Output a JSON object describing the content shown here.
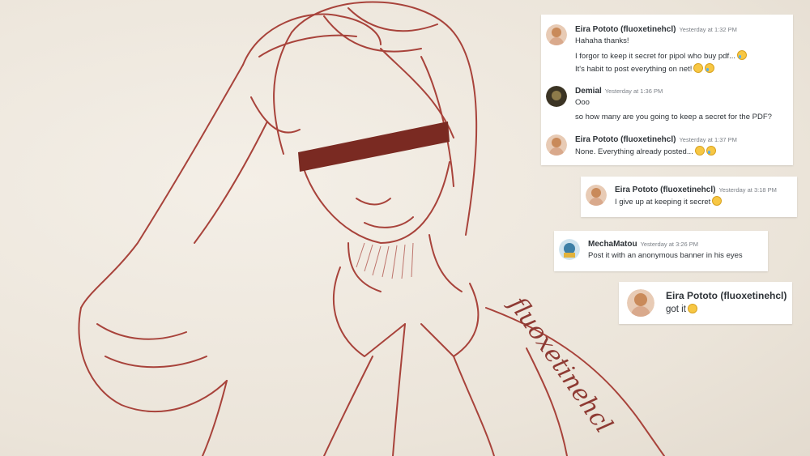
{
  "artwork": {
    "signature": "fluoxetinehcl",
    "censor_bar_color": "#7a2a22",
    "line_color": "#a8433b"
  },
  "chat1": {
    "messages": [
      {
        "user": "Eira Pototo (fluoxetinehcl)",
        "time": "Yesterday at 1:32 PM",
        "lines": [
          "Hahaha thanks!",
          "I forgor to keep it secret for pipol who buy pdf...",
          "It's habit to post everything on net!"
        ]
      },
      {
        "user": "Demial",
        "time": "Yesterday at 1:36 PM",
        "lines": [
          "Ooo",
          "so how many are you going to keep a secret for the PDF?"
        ]
      },
      {
        "user": "Eira Pototo (fluoxetinehcl)",
        "time": "Yesterday at 1:37 PM",
        "lines": [
          "None. Everything already posted..."
        ]
      }
    ]
  },
  "chat2": {
    "user": "Eira Pototo (fluoxetinehcl)",
    "time": "Yesterday at 3:18 PM",
    "text": "I give up at keeping it secret"
  },
  "chat3": {
    "user": "MechaMatou",
    "time": "Yesterday at 3:26 PM",
    "text": "Post it with an anonymous banner in his eyes"
  },
  "chat4": {
    "user": "Eira Pototo (fluoxetinehcl)",
    "text": "got it"
  }
}
